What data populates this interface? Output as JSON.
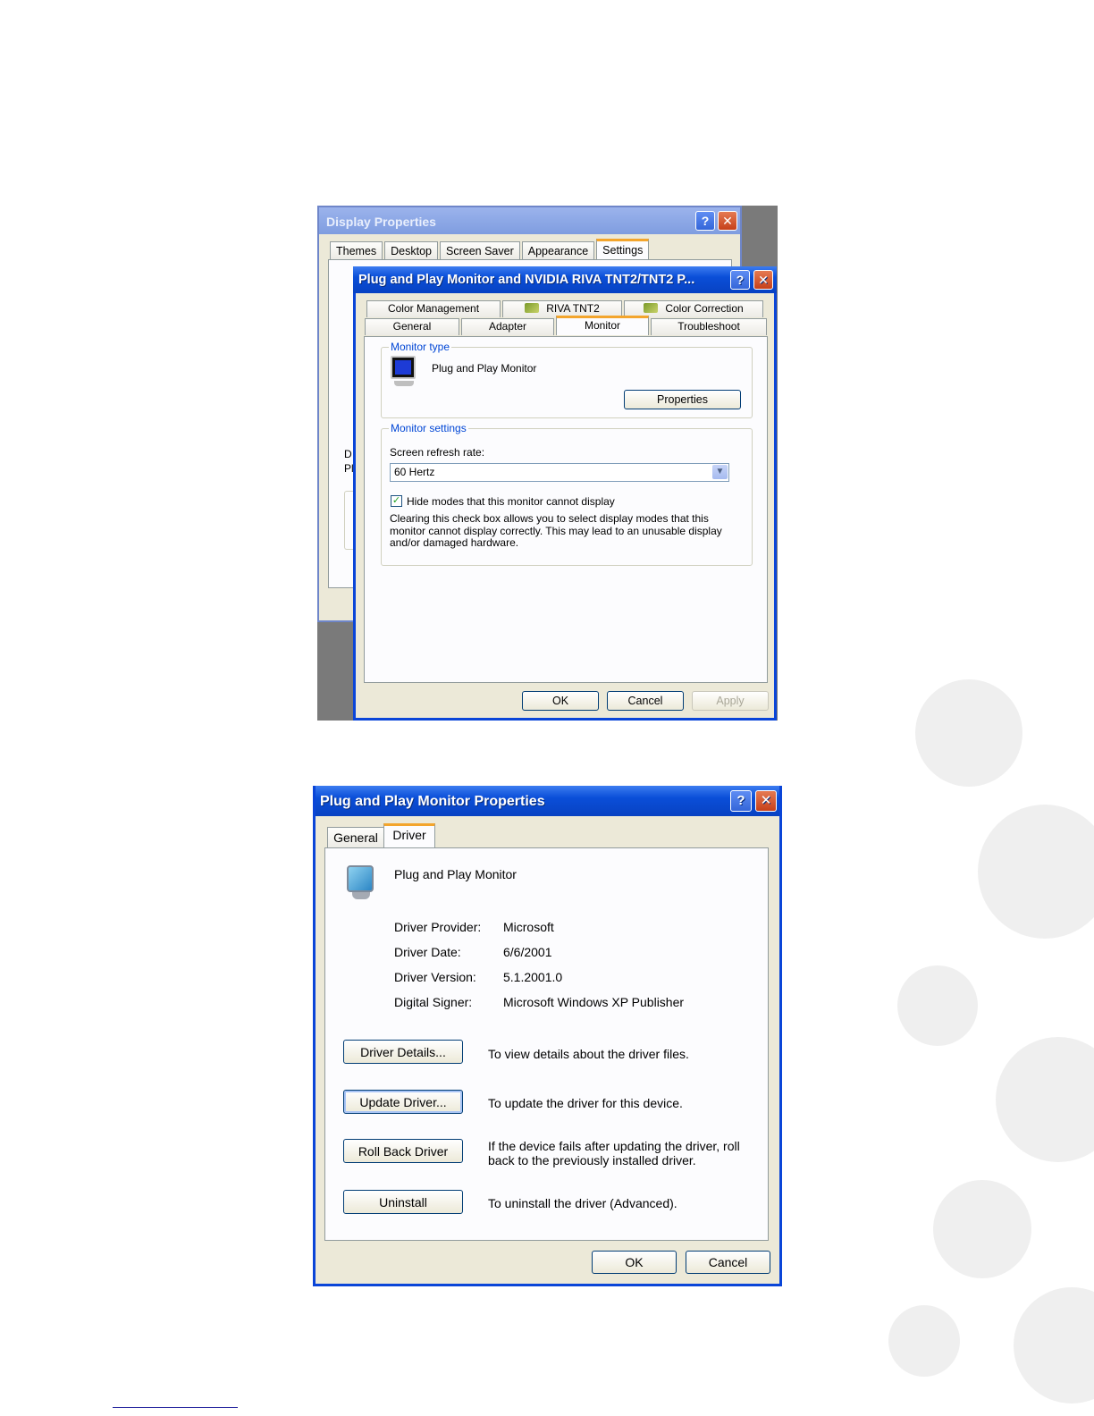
{
  "display_properties": {
    "title": "Display Properties",
    "tabs": [
      "Themes",
      "Desktop",
      "Screen Saver",
      "Appearance",
      "Settings"
    ],
    "active_tab": "Settings",
    "peek_text_1": "D",
    "peek_text_2": "Pl"
  },
  "monitor_dialog": {
    "title": "Plug and Play Monitor and NVIDIA RIVA TNT2/TNT2 P...",
    "tabs_row1": [
      "Color Management",
      "RIVA TNT2",
      "Color Correction"
    ],
    "tabs_row2": [
      "General",
      "Adapter",
      "Monitor",
      "Troubleshoot"
    ],
    "active_tab": "Monitor",
    "monitor_type": {
      "legend": "Monitor type",
      "name": "Plug and Play Monitor",
      "properties_button": "Properties"
    },
    "monitor_settings": {
      "legend": "Monitor settings",
      "refresh_label": "Screen refresh rate:",
      "refresh_value": "60 Hertz",
      "hide_modes_label": "Hide modes that this monitor cannot display",
      "hide_modes_checked": true,
      "warning": "Clearing this check box allows you to select display modes that this monitor cannot display correctly. This may lead to an unusable display and/or damaged hardware."
    },
    "buttons": {
      "ok": "OK",
      "cancel": "Cancel",
      "apply": "Apply"
    }
  },
  "monitor_properties": {
    "title": "Plug and Play Monitor Properties",
    "tabs": [
      "General",
      "Driver"
    ],
    "active_tab": "Driver",
    "device_name": "Plug and Play Monitor",
    "info": [
      {
        "label": "Driver Provider:",
        "value": "Microsoft"
      },
      {
        "label": "Driver Date:",
        "value": "6/6/2001"
      },
      {
        "label": "Driver Version:",
        "value": "5.1.2001.0"
      },
      {
        "label": "Digital Signer:",
        "value": "Microsoft Windows XP Publisher"
      }
    ],
    "actions": [
      {
        "button": "Driver Details...",
        "description": "To view details about the driver files."
      },
      {
        "button": "Update Driver...",
        "description": "To update the driver for this device."
      },
      {
        "button": "Roll Back Driver",
        "description": "If the device fails after updating the driver, roll back to the previously installed driver."
      },
      {
        "button": "Uninstall",
        "description": "To uninstall the driver (Advanced)."
      }
    ],
    "buttons": {
      "ok": "OK",
      "cancel": "Cancel"
    }
  },
  "colors": {
    "xp_blue": "#0a45d8",
    "tab_accent": "#f3a52c",
    "group_legend": "#0046d5",
    "dialog_bg": "#ece9d8"
  },
  "icons": {
    "help": "help-icon",
    "close": "close-icon",
    "monitor": "monitor-icon",
    "nvidia": "nvidia-icon",
    "dropdown": "chevron-down-icon",
    "check": "checkmark-icon"
  }
}
